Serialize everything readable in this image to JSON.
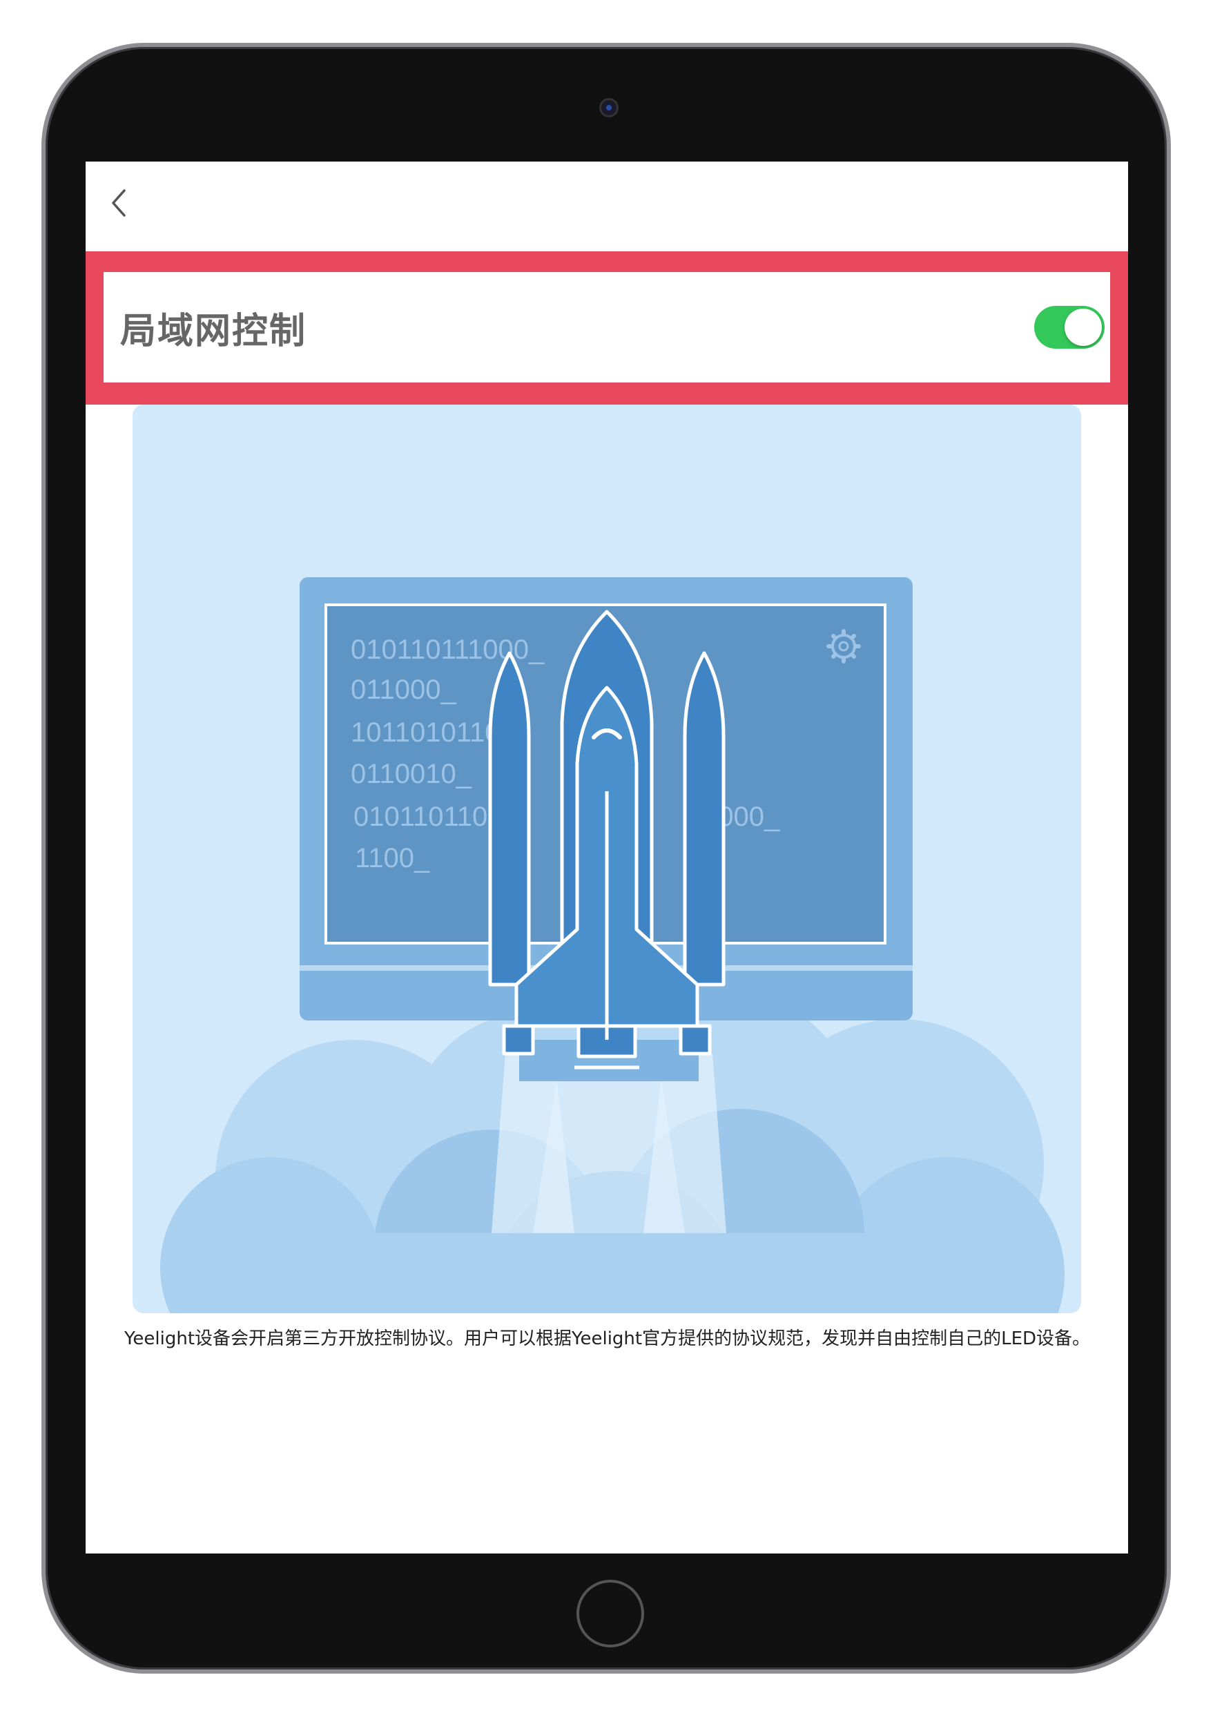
{
  "header": {
    "back_icon": "chevron-left-icon"
  },
  "setting": {
    "label": "局域网控制",
    "toggle_on": true,
    "toggle_color": "#34c759",
    "highlight_color": "#e8485c"
  },
  "illustration": {
    "code_lines": [
      "010110111000_",
      "011000_",
      "1011010110",
      "0110010_",
      "0101101100",
      "1100_",
      "1000_"
    ],
    "background_color": "#d2e9fc"
  },
  "description": {
    "text": "Yeelight设备会开启第三方开放控制协议。用户可以根据Yeelight官方提供的协议规范，发现并自由控制自己的LED设备。"
  }
}
